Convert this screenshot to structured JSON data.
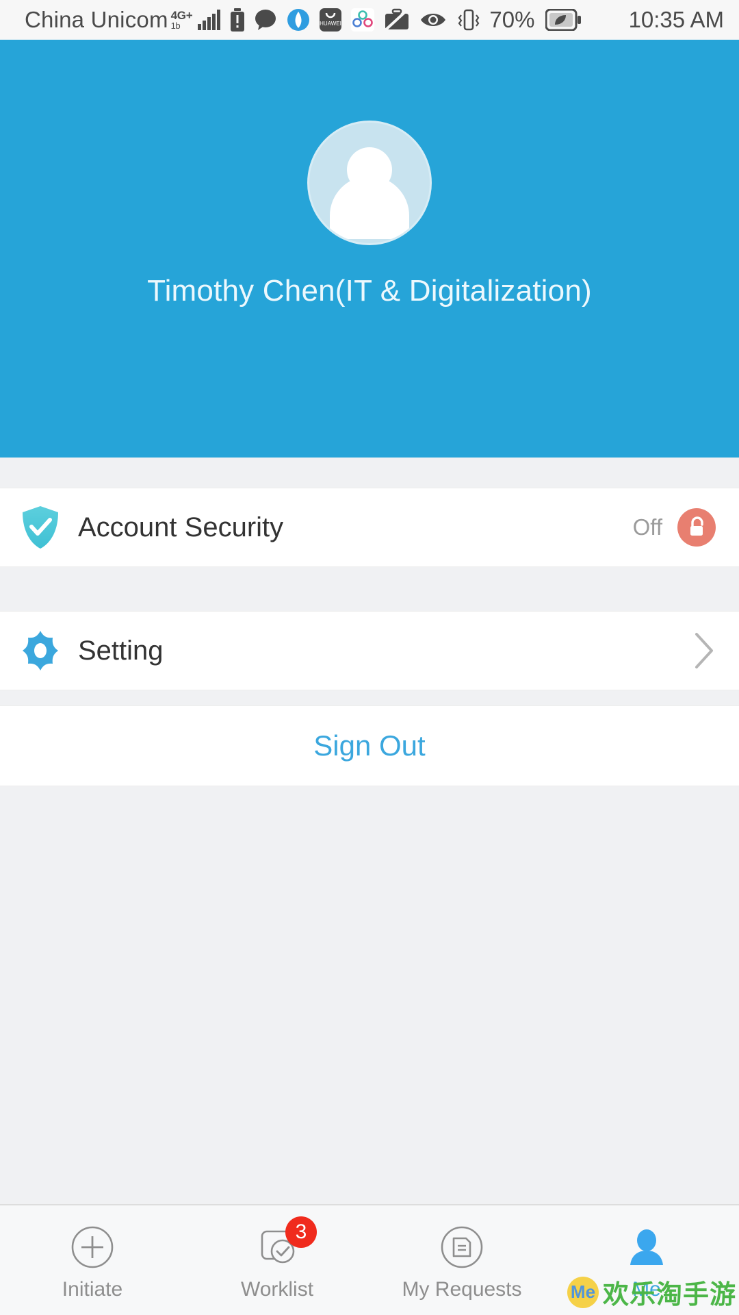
{
  "statusbar": {
    "carrier": "China Unicom",
    "network_type": "4G+",
    "network_sub": "1b",
    "battery_percent": "70%",
    "time": "10:35 AM",
    "icons": [
      "signal-bars-icon",
      "sim-alert-icon",
      "message-bubble-icon",
      "browser-icon",
      "huawei-appgallery-icon",
      "sync-icon",
      "work-mode-off-icon",
      "eye-comfort-icon",
      "vibrate-icon",
      "battery-saver-icon"
    ]
  },
  "profile": {
    "avatar_icon": "default-user-avatar",
    "name": "Timothy Chen(IT & Digitalization)",
    "header_color": "#26a4d8"
  },
  "rows": [
    {
      "icon": "shield-check-icon",
      "label": "Account Security",
      "value": "Off",
      "badge_icon": "unlock-icon",
      "badge_color": "#e87f70"
    },
    {
      "icon": "gear-icon",
      "label": "Setting",
      "value": "",
      "chevron": "chevron-right-icon"
    }
  ],
  "signout": {
    "label": "Sign Out",
    "color": "#3ba7de"
  },
  "tabbar": {
    "items": [
      {
        "icon": "plus-circle-icon",
        "label": "Initiate",
        "badge": "",
        "active": false
      },
      {
        "icon": "worklist-check-icon",
        "label": "Worklist",
        "badge": "3",
        "active": false
      },
      {
        "icon": "document-circle-icon",
        "label": "My Requests",
        "badge": "",
        "active": false
      },
      {
        "icon": "person-icon",
        "label": "Me",
        "badge": "",
        "active": true
      }
    ],
    "badge_color": "#f02b1d",
    "active_color": "#3ba7de"
  },
  "watermark": {
    "logo_text": "Me",
    "text": "欢乐淘手游"
  }
}
